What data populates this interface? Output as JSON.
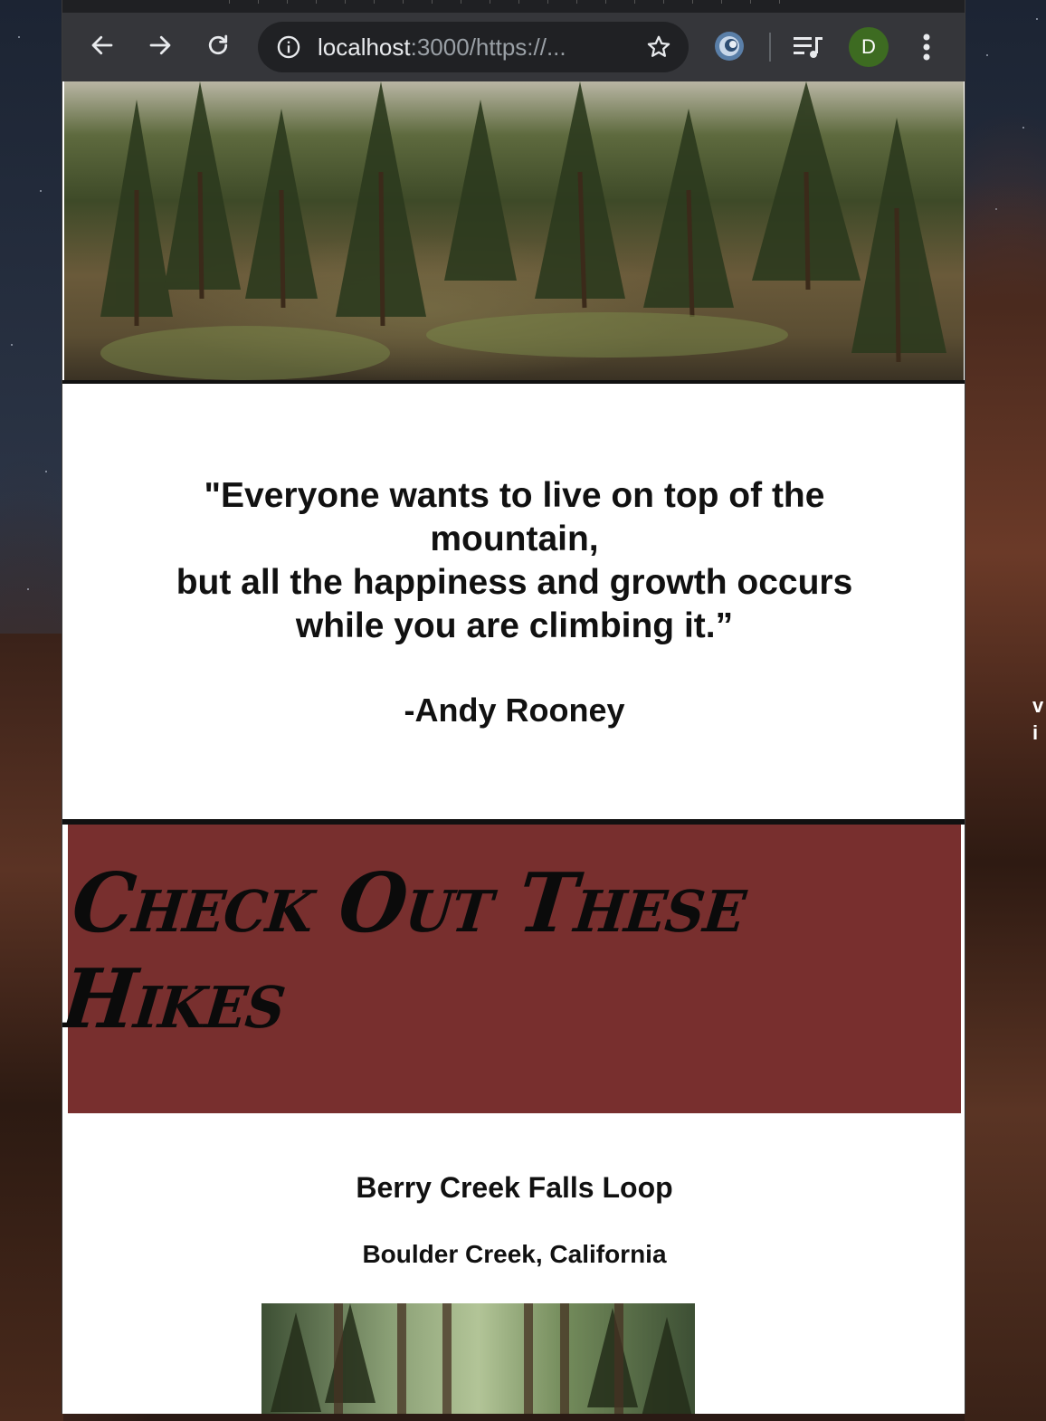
{
  "browser": {
    "url_host": "localhost",
    "url_rest": ":3000/https://...",
    "profile_initial": "D"
  },
  "icons": {
    "back": "arrow-left-icon",
    "forward": "arrow-right-icon",
    "reload": "reload-icon",
    "site_info": "info-icon",
    "bookmark": "star-icon",
    "extension": "extension-icon",
    "media": "media-queue-icon",
    "menu": "kebab-menu-icon"
  },
  "quote": {
    "lines": [
      "\"Everyone wants to live on top of the mountain,",
      "but all the happiness and growth occurs while you are climbing it.”"
    ],
    "author": "-Andy Rooney"
  },
  "hikes": {
    "heading": "Check Out These Hikes",
    "items": [
      {
        "name": "Berry Creek Falls Loop",
        "location": "Boulder Creek, California"
      }
    ]
  },
  "background_text": "v\ni",
  "colors": {
    "toolbar": "#35363a",
    "omnibox": "#202124",
    "hikes_header_bg": "#782f2e",
    "avatar_bg": "#3d6b21"
  }
}
